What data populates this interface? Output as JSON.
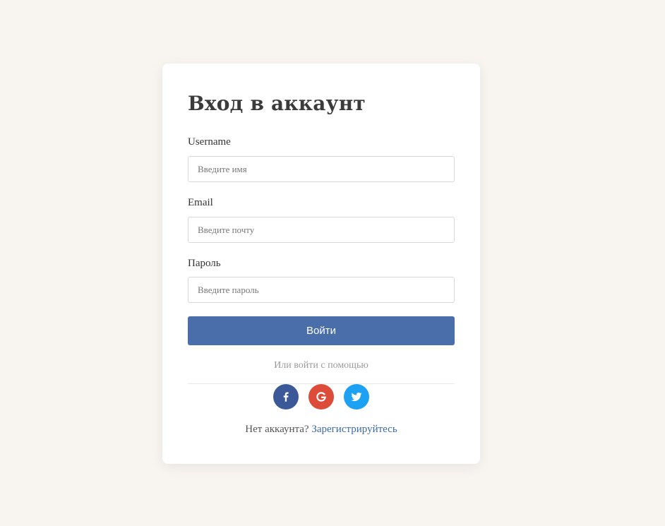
{
  "form": {
    "title": "Вход в аккаунт",
    "username": {
      "label": "Username",
      "placeholder": "Введите имя",
      "value": ""
    },
    "email": {
      "label": "Email",
      "placeholder": "Введите почту",
      "value": ""
    },
    "password": {
      "label": "Пароль",
      "placeholder": "Введите пароль",
      "value": ""
    },
    "submit_label": "Войти",
    "social_caption": "Или войти с помощью",
    "social": [
      {
        "name": "facebook",
        "icon": "facebook-icon",
        "color": "#3b5998"
      },
      {
        "name": "google",
        "icon": "google-icon",
        "color": "#dd4b39"
      },
      {
        "name": "twitter",
        "icon": "twitter-icon",
        "color": "#1da1f2"
      }
    ],
    "footer_text": "Нет аккаунта?",
    "register_link": "Зарегистрируйтесь"
  },
  "colors": {
    "page_background": "#f8f5f1",
    "primary_button": "#4a6ea9",
    "link": "#3b6aa6"
  }
}
